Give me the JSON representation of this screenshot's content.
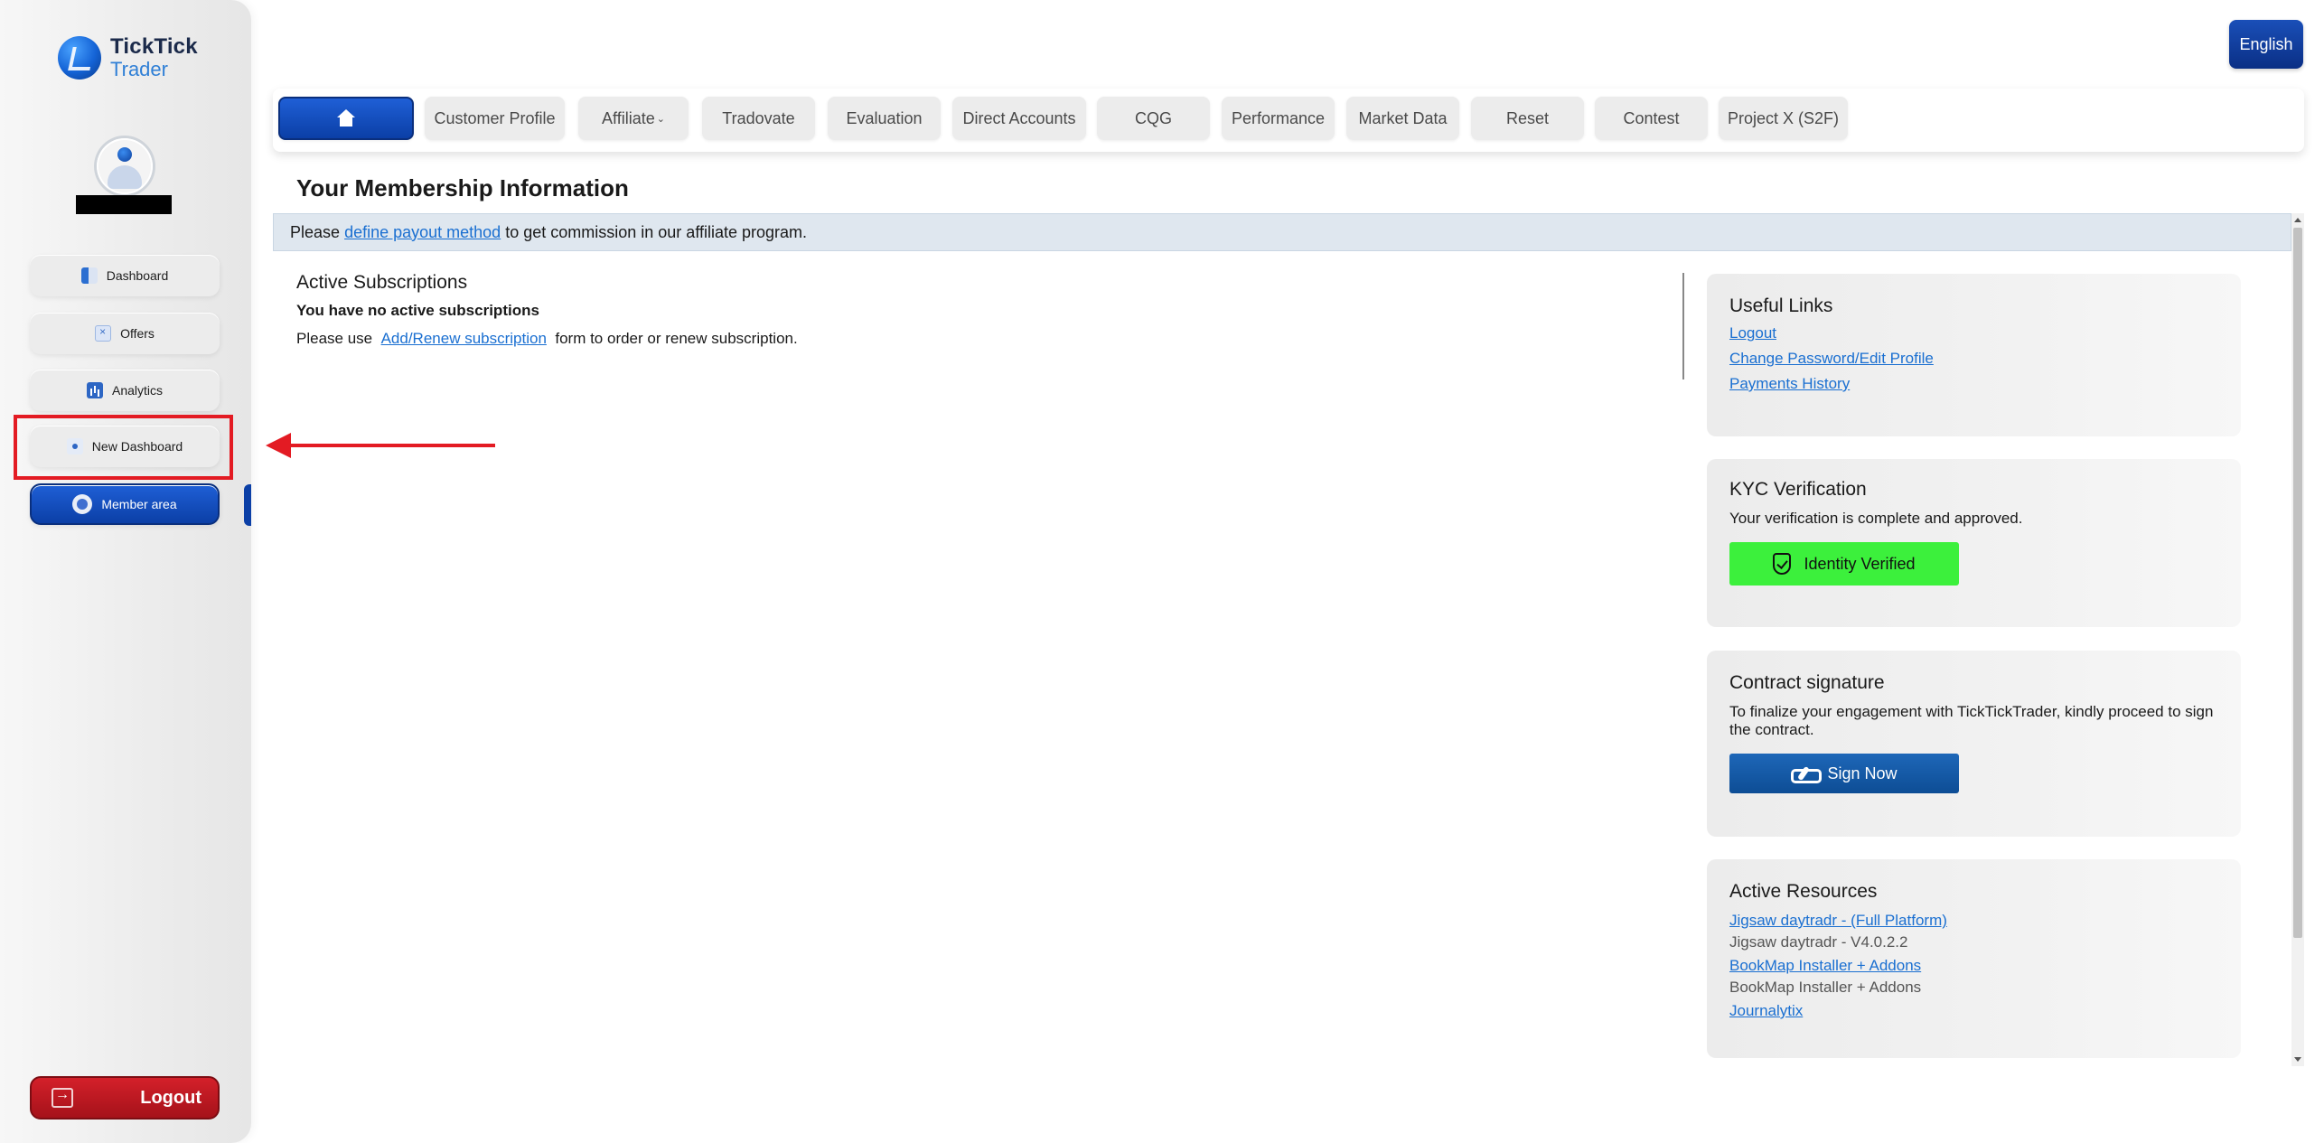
{
  "brand": {
    "line1": "TickTick",
    "line2": "Trader"
  },
  "sidebar": {
    "items": [
      {
        "label": "Dashboard",
        "icon": "dashboard-icon"
      },
      {
        "label": "Offers",
        "icon": "offers-icon"
      },
      {
        "label": "Analytics",
        "icon": "analytics-icon"
      },
      {
        "label": "New Dashboard",
        "icon": "new-dashboard-icon"
      },
      {
        "label": "Member area",
        "icon": "member-icon",
        "active": true
      }
    ],
    "logout_label": "Logout"
  },
  "header": {
    "language": "English"
  },
  "topnav": {
    "home_icon": "home-icon",
    "tabs": [
      "Customer Profile",
      "Affiliate",
      "Tradovate",
      "Evaluation",
      "Direct Accounts",
      "CQG",
      "Performance",
      "Market Data",
      "Reset",
      "Contest",
      "Project X (S2F)"
    ],
    "affiliate_caret": "⌄"
  },
  "main": {
    "title": "Your Membership Information",
    "notice": {
      "pre": "Please ",
      "link": "define payout method",
      "post": " to get commission in our affiliate program."
    },
    "subscriptions": {
      "title": "Active Subscriptions",
      "none": "You have no active subscriptions",
      "use_pre": "Please use ",
      "use_link": "Add/Renew subscription",
      "use_post": " form to order or renew subscription."
    }
  },
  "cards": {
    "useful_links": {
      "title": "Useful Links",
      "links": [
        "Logout",
        "Change Password/Edit Profile",
        "Payments History"
      ]
    },
    "kyc": {
      "title": "KYC Verification",
      "text": "Your verification is complete and approved.",
      "button": "Identity Verified"
    },
    "contract": {
      "title": "Contract signature",
      "text": "To finalize your engagement with TickTickTrader, kindly proceed to sign the contract.",
      "button": "Sign Now"
    },
    "resources": {
      "title": "Active Resources",
      "items": [
        {
          "link": "Jigsaw daytradr - (Full Platform)",
          "sub": "Jigsaw daytradr - V4.0.2.2"
        },
        {
          "link": "BookMap Installer + Addons",
          "sub": "BookMap Installer + Addons"
        },
        {
          "link": "Journalytix",
          "sub": ""
        }
      ]
    }
  },
  "colors": {
    "primary": "#0b3fa6",
    "highlight": "#e31b23",
    "verified": "#3cf03c",
    "logout": "#c41a23"
  }
}
